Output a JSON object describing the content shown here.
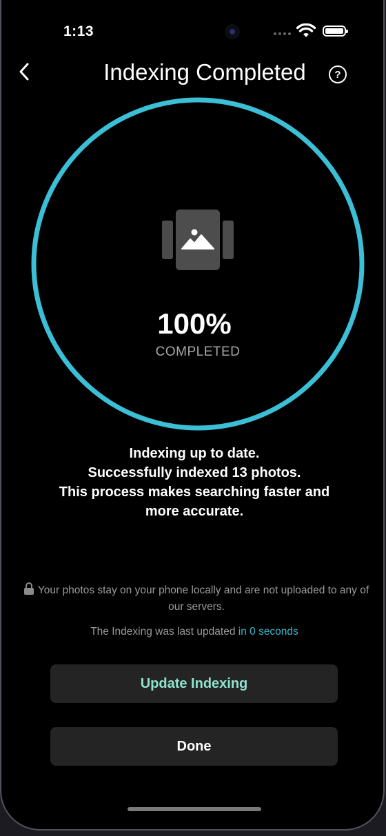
{
  "status_bar": {
    "time": "1:13"
  },
  "nav": {
    "title": "Indexing Completed",
    "back_icon": "chevron-left-icon",
    "help_icon": "question-mark-icon",
    "help_label": "?"
  },
  "progress": {
    "percent_label": "100%",
    "status_label": "COMPLETED",
    "fraction": 1.0,
    "ring_color": "#3bbfd6",
    "center_icon": "photo-stack-icon"
  },
  "message": {
    "lines": [
      "Indexing up to date.",
      "Successfully indexed 13 photos.",
      "This process makes searching faster and",
      "more accurate."
    ]
  },
  "privacy": {
    "icon": "lock-icon",
    "text": "Your photos stay on your phone locally and are not uploaded to any of our servers."
  },
  "last_updated": {
    "prefix": "The Indexing was last updated ",
    "value": "in 0 seconds",
    "highlight_color": "#3bb8c9"
  },
  "buttons": {
    "update_label": "Update Indexing",
    "done_label": "Done"
  }
}
